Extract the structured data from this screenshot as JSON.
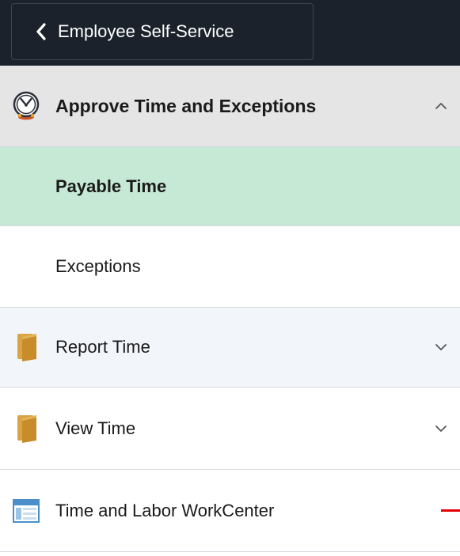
{
  "topbar": {
    "back_label": "Employee Self-Service"
  },
  "menu": {
    "group": {
      "label": "Approve Time and Exceptions",
      "icon": "clock-approve-icon",
      "expanded": true,
      "items": [
        {
          "label": "Payable Time",
          "selected": true
        },
        {
          "label": "Exceptions",
          "selected": false
        }
      ]
    },
    "items": [
      {
        "label": "Report Time",
        "icon": "folder-icon",
        "expanded": false
      },
      {
        "label": "View Time",
        "icon": "folder-icon",
        "expanded": false
      },
      {
        "label": "Time and Labor WorkCenter",
        "icon": "workcenter-icon"
      }
    ]
  },
  "colors": {
    "topbar_bg": "#1b222b",
    "selected_bg": "#c6e9d6",
    "header_bg": "#e5e5e5",
    "hover_bg": "#f2f5fa",
    "annotation_red": "#e30000"
  }
}
